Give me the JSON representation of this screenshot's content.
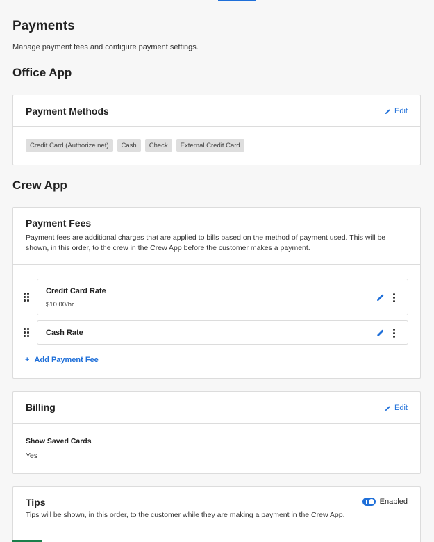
{
  "page": {
    "title": "Payments",
    "subtitle": "Manage payment fees and configure payment settings."
  },
  "office_app": {
    "section_title": "Office App",
    "payment_methods": {
      "title": "Payment Methods",
      "edit_label": "Edit",
      "methods": [
        "Credit Card (Authorize.net)",
        "Cash",
        "Check",
        "External Credit Card"
      ]
    }
  },
  "crew_app": {
    "section_title": "Crew App",
    "payment_fees": {
      "title": "Payment Fees",
      "description": "Payment fees are additional charges that are applied to bills based on the method of payment used. This will be shown, in this order, to the crew in the Crew App before the customer makes a payment.",
      "fees": [
        {
          "name": "Credit Card Rate",
          "amount": "$10.00/hr"
        },
        {
          "name": "Cash Rate",
          "amount": ""
        }
      ],
      "add_label": "Add Payment Fee"
    },
    "billing": {
      "title": "Billing",
      "edit_label": "Edit",
      "field_label": "Show Saved Cards",
      "field_value": "Yes"
    },
    "tips": {
      "title": "Tips",
      "toggle_label": "Enabled",
      "toggle_on": true,
      "description": "Tips will be shown, in this order, to the customer while they are making a payment in the Crew App."
    }
  },
  "colors": {
    "accent": "#1e6fd9",
    "tag_bg": "#dedede",
    "border": "#dcdcdc"
  }
}
